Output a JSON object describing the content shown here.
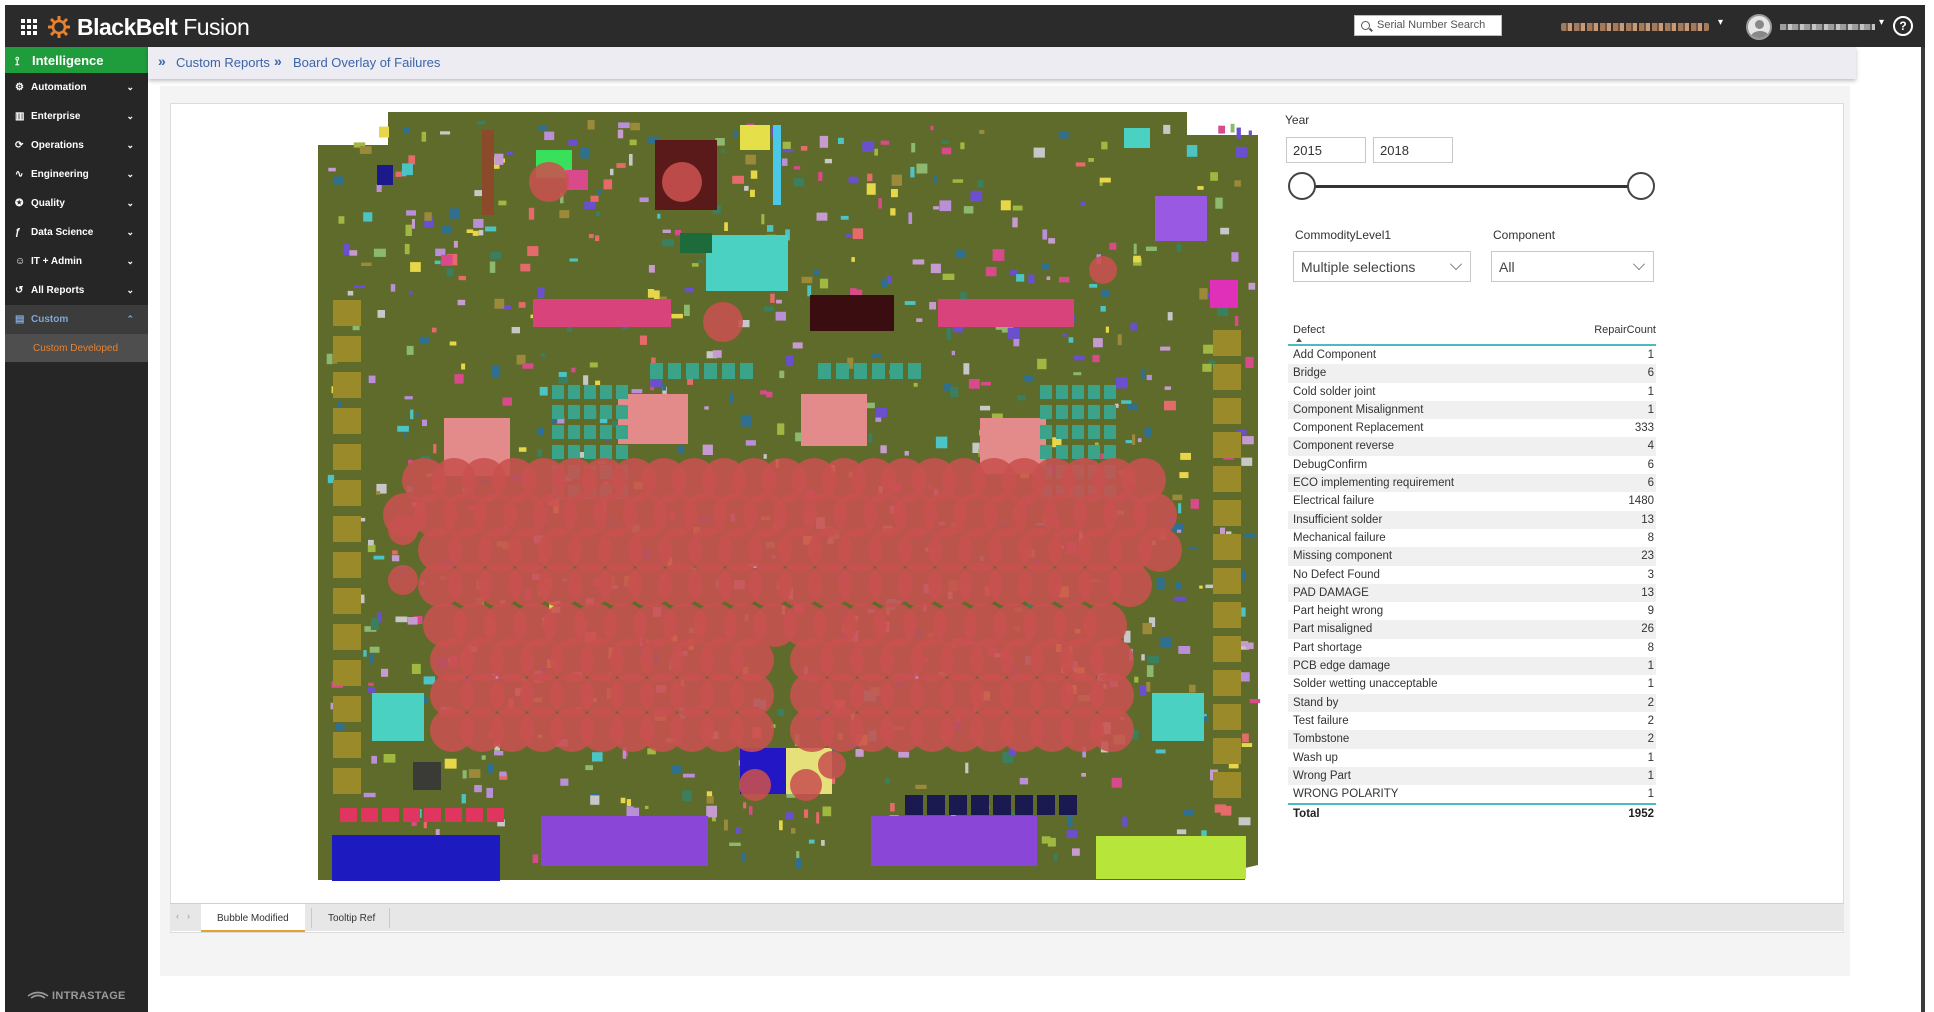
{
  "app": {
    "brand_bold": "BlackBelt",
    "brand_light": " Fusion",
    "search_placeholder": "Serial Number Search",
    "help_glyph": "?"
  },
  "sidebar": {
    "active_section": "Intelligence",
    "items": [
      {
        "label": "Automation",
        "icon": "cog-icon"
      },
      {
        "label": "Enterprise",
        "icon": "bar-chart-icon"
      },
      {
        "label": "Operations",
        "icon": "refresh-icon"
      },
      {
        "label": "Engineering",
        "icon": "waveform-icon"
      },
      {
        "label": "Quality",
        "icon": "badge-icon"
      },
      {
        "label": "Data Science",
        "icon": "function-icon"
      },
      {
        "label": "IT + Admin",
        "icon": "user-gear-icon"
      },
      {
        "label": "All Reports",
        "icon": "history-icon"
      }
    ],
    "custom": {
      "label": "Custom",
      "sub_label": "Custom Developed"
    },
    "footer": "INTRASTAGE"
  },
  "breadcrumb": {
    "items": [
      "Custom Reports",
      "Board Overlay of Failures"
    ]
  },
  "slicer": {
    "year_label": "Year",
    "year_from": "2015",
    "year_to": "2018",
    "commodity_label": "CommodityLevel1",
    "commodity_value": "Multiple selections",
    "component_label": "Component",
    "component_value": "All"
  },
  "table": {
    "col_defect": "Defect",
    "col_count": "RepairCount",
    "rows": [
      {
        "defect": "Add Component",
        "count": "1"
      },
      {
        "defect": "Bridge",
        "count": "6"
      },
      {
        "defect": "Cold solder joint",
        "count": "1"
      },
      {
        "defect": "Component Misalignment",
        "count": "1"
      },
      {
        "defect": "Component Replacement",
        "count": "333"
      },
      {
        "defect": "Component reverse",
        "count": "4"
      },
      {
        "defect": "DebugConfirm",
        "count": "6"
      },
      {
        "defect": "ECO implementing requirement",
        "count": "6"
      },
      {
        "defect": "Electrical failure",
        "count": "1480"
      },
      {
        "defect": "Insufficient solder",
        "count": "13"
      },
      {
        "defect": "Mechanical failure",
        "count": "8"
      },
      {
        "defect": "Missing component",
        "count": "23"
      },
      {
        "defect": "No Defect Found",
        "count": "3"
      },
      {
        "defect": "PAD DAMAGE",
        "count": "13"
      },
      {
        "defect": "Part height wrong",
        "count": "9"
      },
      {
        "defect": "Part misaligned",
        "count": "26"
      },
      {
        "defect": "Part shortage",
        "count": "8"
      },
      {
        "defect": "PCB edge damage",
        "count": "1"
      },
      {
        "defect": "Solder wetting unacceptable",
        "count": "1"
      },
      {
        "defect": "Stand by",
        "count": "2"
      },
      {
        "defect": "Test failure",
        "count": "2"
      },
      {
        "defect": "Tombstone",
        "count": "2"
      },
      {
        "defect": "Wash up",
        "count": "1"
      },
      {
        "defect": "Wrong Part",
        "count": "1"
      },
      {
        "defect": "WRONG POLARITY",
        "count": "1"
      }
    ],
    "total_label": "Total",
    "total_value": "1952"
  },
  "tabs": [
    "Bubble Modified",
    "Tooltip Ref"
  ],
  "colors": {
    "topbar": "#2b2b2b",
    "sidebar": "#262626",
    "accent_green": "#1f9d3c",
    "link_blue": "#3c64a8",
    "board_green": "#5f6b2a",
    "bubble_red": "#c8514f",
    "table_rule": "#4fb8c5",
    "tab_underline": "#e8a130"
  }
}
